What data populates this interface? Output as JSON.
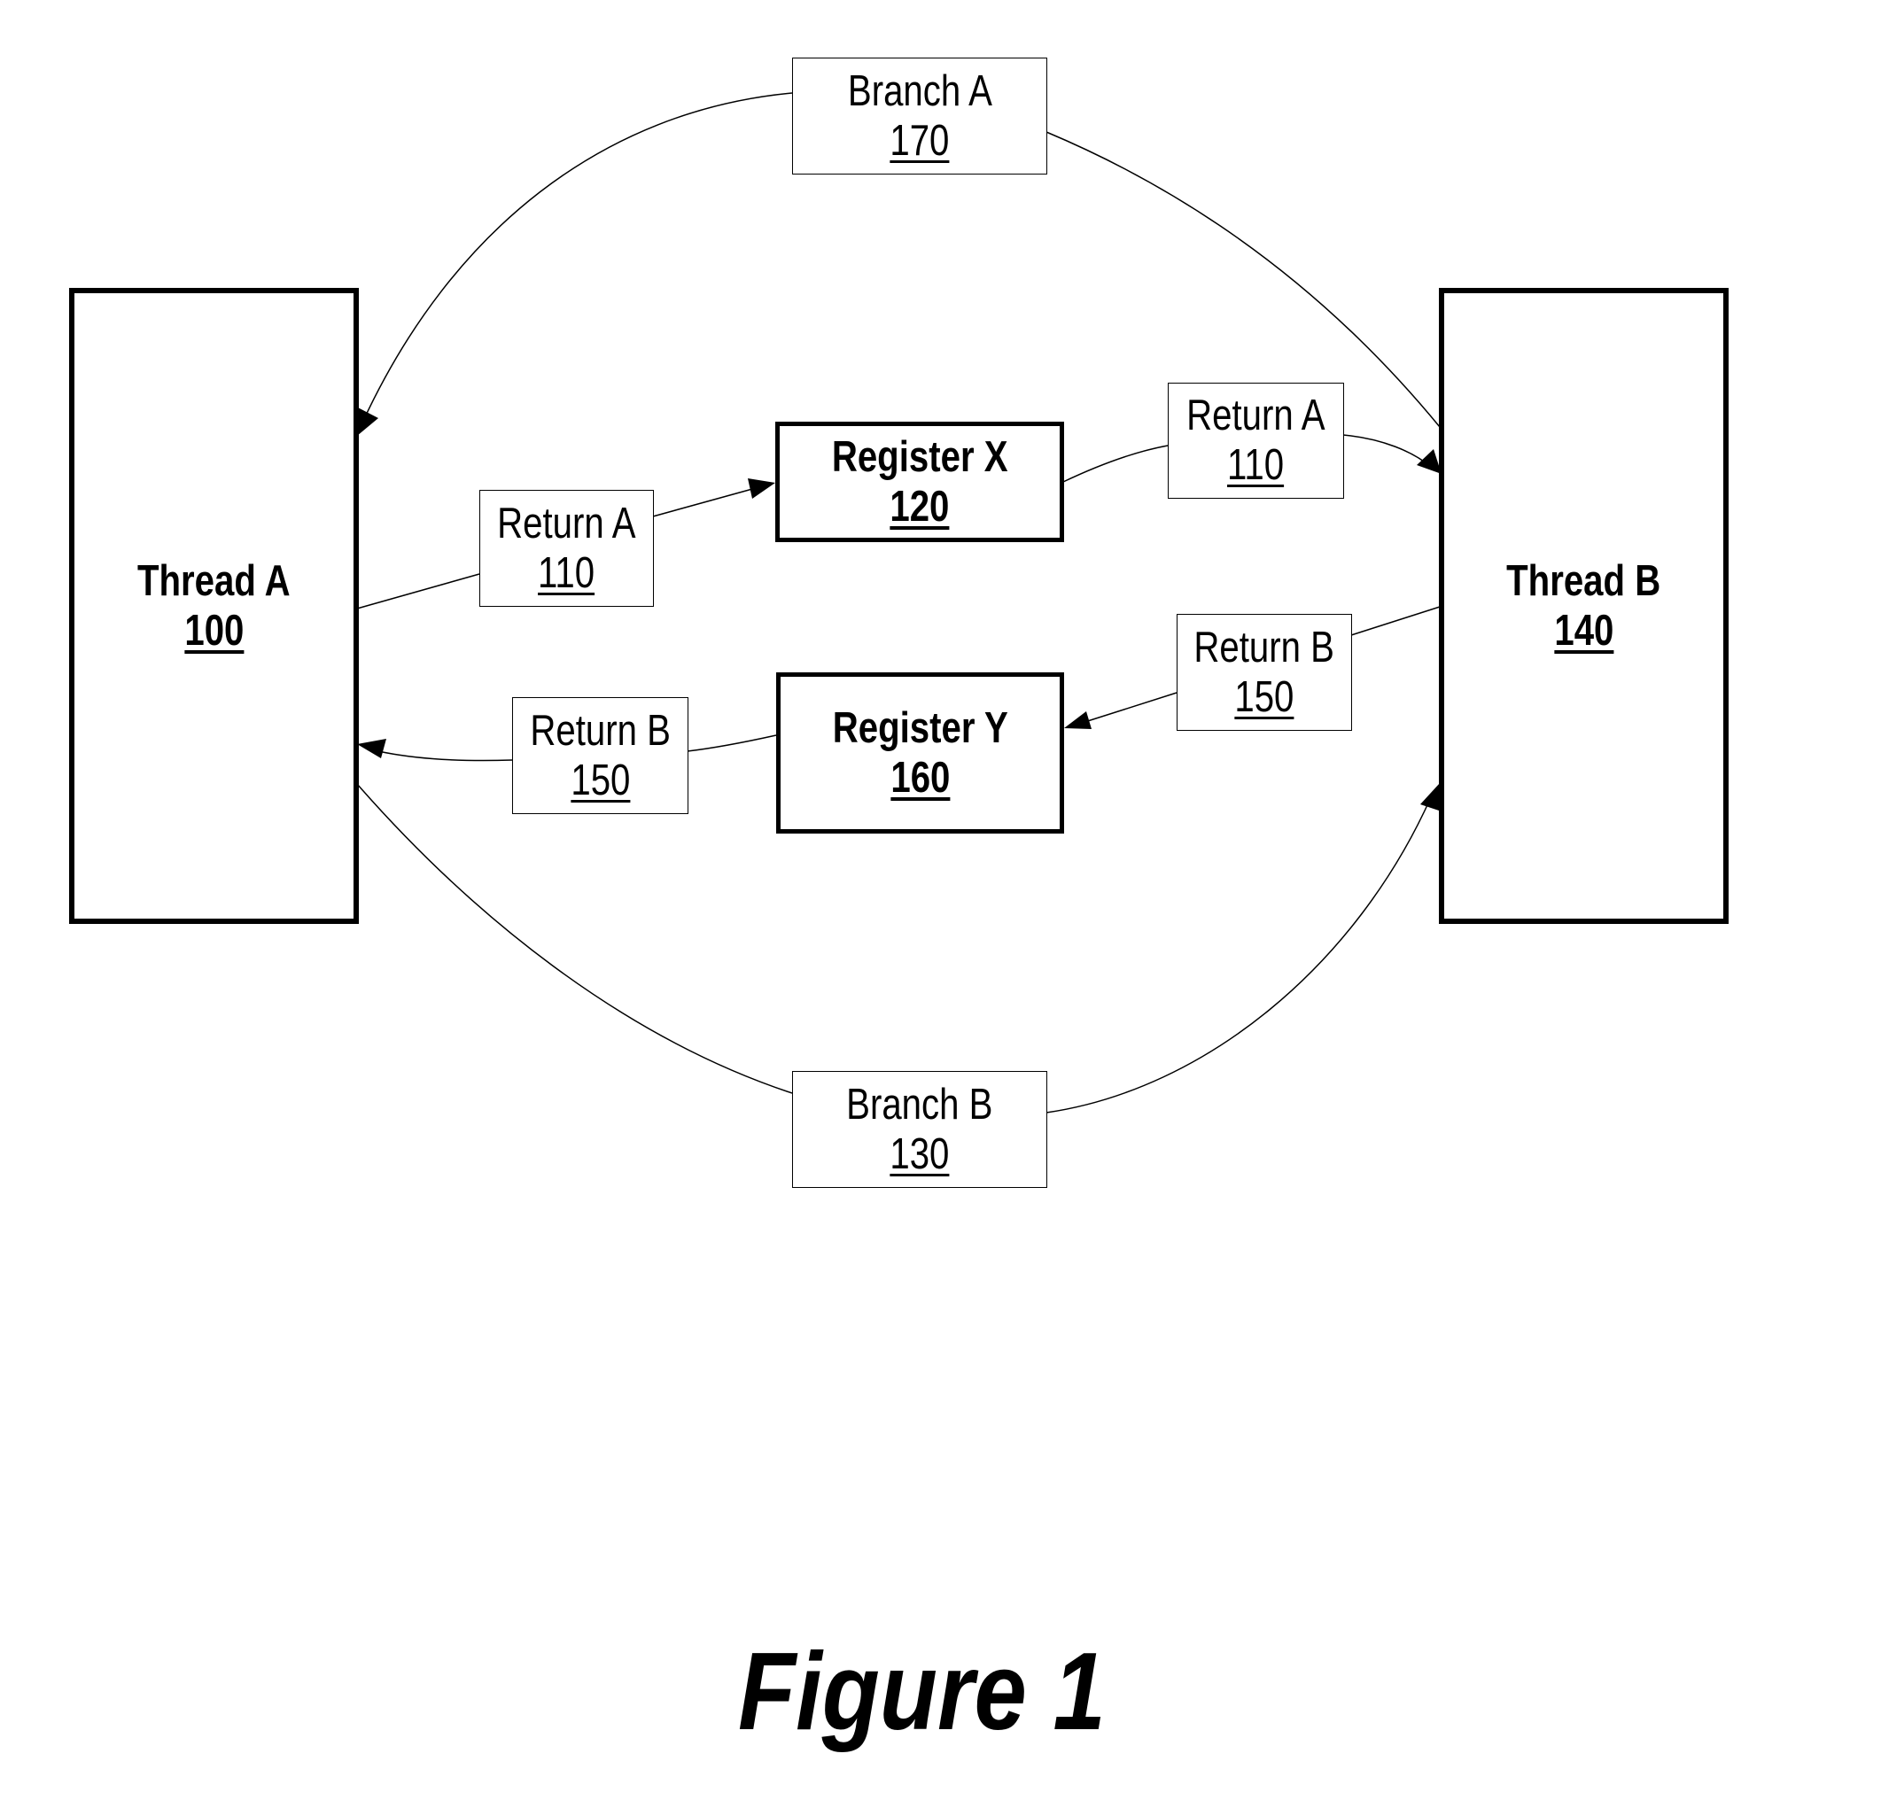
{
  "figure": {
    "caption": "Figure 1"
  },
  "nodes": {
    "thread_a": {
      "title": "Thread A",
      "ref": "100"
    },
    "thread_b": {
      "title": "Thread B",
      "ref": "140"
    },
    "register_x": {
      "title": "Register X",
      "ref": "120"
    },
    "register_y": {
      "title": "Register Y",
      "ref": "160"
    }
  },
  "edge_labels": {
    "branch_a": {
      "title": "Branch A",
      "ref": "170"
    },
    "branch_b": {
      "title": "Branch B",
      "ref": "130"
    },
    "return_a_left": {
      "title": "Return A",
      "ref": "110"
    },
    "return_a_right": {
      "title": "Return A",
      "ref": "110"
    },
    "return_b_left": {
      "title": "Return B",
      "ref": "150"
    },
    "return_b_right": {
      "title": "Return B",
      "ref": "150"
    }
  },
  "edges": [
    {
      "from": "Thread B",
      "via": "Branch A 170",
      "to": "Thread A"
    },
    {
      "from": "Thread A",
      "via": "Branch B 130",
      "to": "Thread B"
    },
    {
      "from": "Thread A",
      "via": "Return A 110",
      "to": "Register X"
    },
    {
      "from": "Register X",
      "via": "Return A 110",
      "to": "Thread B"
    },
    {
      "from": "Thread B",
      "via": "Return B 150",
      "to": "Register Y"
    },
    {
      "from": "Register Y",
      "via": "Return B 150",
      "to": "Thread A"
    }
  ],
  "colors": {
    "stroke": "#000000",
    "background": "#ffffff"
  }
}
